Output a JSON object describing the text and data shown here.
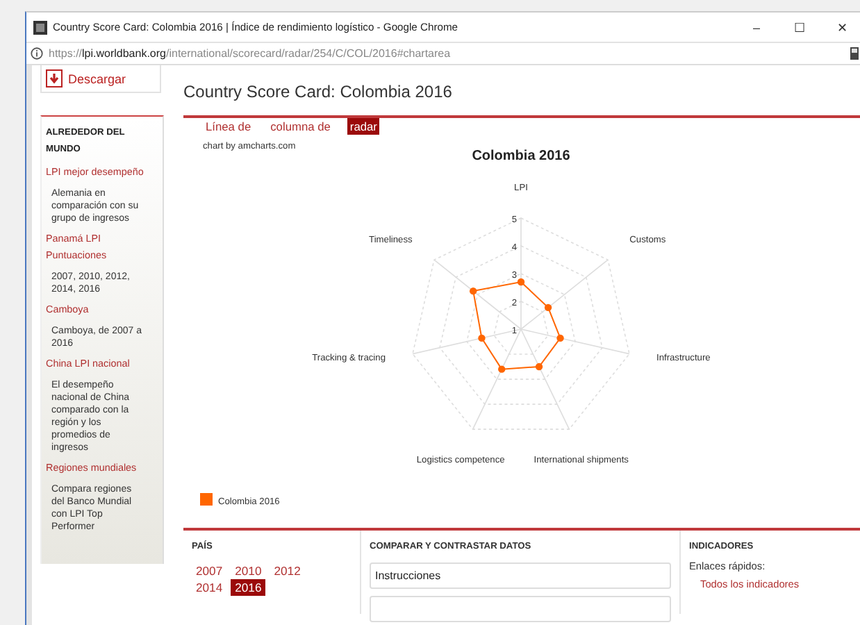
{
  "window": {
    "title": "Country Score Card: Colombia 2016 | Índice de rendimiento logístico - Google Chrome",
    "controls": [
      "–",
      "☐",
      "✕"
    ]
  },
  "address_bar": {
    "url": "https://**lpi.worldbank.org**/international/scorecard/radar/254/C/COL/2016#chartarea"
  },
  "download": {
    "label": "Descargar"
  },
  "sidebar": {
    "heading": "ALREDEDOR DEL MUNDO",
    "items": [
      {
        "link": "LPI mejor desempeño",
        "description": "Alemania en comparación con su grupo de ingresos"
      },
      {
        "link": "Panamá LPI Puntuaciones",
        "description": "2007, 2010, 2012, 2014, 2016"
      },
      {
        "link": "Camboya",
        "description": "Camboya, de 2007 a 2016"
      },
      {
        "link": "China LPI nacional",
        "description": "El desempeño nacional de China comparado con la región y los promedios de ingresos"
      },
      {
        "link": "Regiones mundiales",
        "description": "Compara regiones del Banco Mundial con LPI Top Performer"
      }
    ]
  },
  "page_title": "Country Score Card: Colombia 2016",
  "chart_tabs": [
    {
      "label": "Línea de",
      "selected": false
    },
    {
      "label": "columna de",
      "selected": false
    },
    {
      "label": "radar",
      "selected": true
    }
  ],
  "chart_credit": "chart by amcharts.com",
  "radar_chart": {
    "title": "Colombia 2016",
    "axes": [
      "LPI",
      "Timeliness",
      "Customs",
      "Tracking & tracing",
      "Infrastructure",
      "Logistics competence",
      "International shipments"
    ],
    "ticks": [
      "5",
      "4",
      "3",
      "2",
      "1"
    ],
    "legend": [
      {
        "name": "Colombia 2016",
        "color": "#ff6600"
      }
    ]
  },
  "country": {
    "heading": "PAÍS",
    "years": [
      {
        "label": "2007",
        "selected": false
      },
      {
        "label": "2010",
        "selected": false
      },
      {
        "label": "2012",
        "selected": false
      },
      {
        "label": "2014",
        "selected": false
      },
      {
        "label": "2016",
        "selected": true
      }
    ]
  },
  "compare": {
    "heading": "COMPARAR Y CONTRASTAR DATOS",
    "instructions": "Instrucciones"
  },
  "indicators": {
    "heading": "INDICADORES",
    "quick_links": "Enlaces rápidos:",
    "link": "Todos los indicadores"
  }
}
